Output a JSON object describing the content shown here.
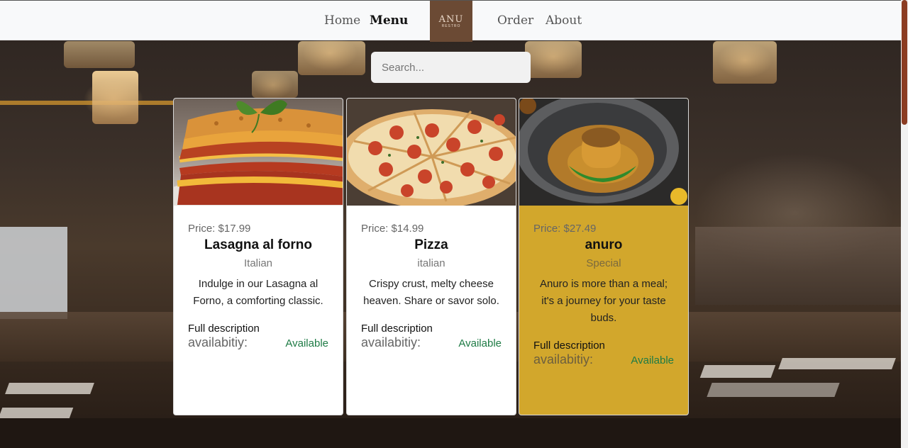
{
  "nav": {
    "links": [
      "Home",
      "Menu",
      "Order",
      "About"
    ],
    "logo_text": "ANU",
    "logo_sub": "RESTRO"
  },
  "search": {
    "placeholder": "Search..."
  },
  "cards": [
    {
      "price": "Price: $17.99",
      "name": "Lasagna al forno",
      "category": "Italian",
      "description": "Indulge in our Lasagna al Forno, a comforting classic.",
      "full_label": "Full description",
      "availability_label": "availabitiy:",
      "availability_status": "Available",
      "image_icon": "lasagna-photo"
    },
    {
      "price": "Price: $14.99",
      "name": "Pizza",
      "category": "italian",
      "description": "Crispy crust, melty cheese heaven. Share or savor solo.",
      "full_label": "Full description",
      "availability_label": "availabitiy:",
      "availability_status": "Available",
      "image_icon": "pizza-photo"
    },
    {
      "price": "Price: $27.49",
      "name": "anuro",
      "category": "Special",
      "description": "Anuro is more than a meal; it's a journey for your taste buds.",
      "full_label": "Full description",
      "availability_label": "availabitiy:",
      "availability_status": "Available",
      "image_icon": "anuro-photo"
    }
  ],
  "colors": {
    "special_card": "#d2a72c",
    "available": "#1e7b45",
    "logo_bg": "#6b4a34",
    "scroll_thumb": "#8b3c22"
  }
}
